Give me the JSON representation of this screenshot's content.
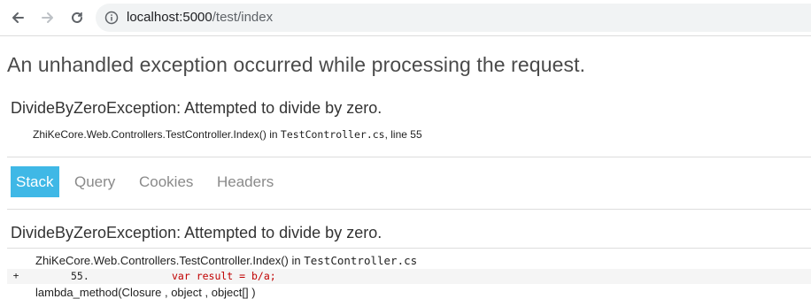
{
  "browser": {
    "url_host": "localhost:5000",
    "url_path": "/test/index"
  },
  "page": {
    "title": "An unhandled exception occurred while processing the request."
  },
  "exception": {
    "title": "DivideByZeroException: Attempted to divide by zero.",
    "method": "ZhiKeCore.Web.Controllers.TestController.Index() in ",
    "file": "TestController.cs",
    "line_text": ", line 55"
  },
  "tabs": [
    {
      "label": "Stack"
    },
    {
      "label": "Query"
    },
    {
      "label": "Cookies"
    },
    {
      "label": "Headers"
    }
  ],
  "stack": {
    "title": "DivideByZeroException: Attempted to divide by zero.",
    "frame_method": "ZhiKeCore.Web.Controllers.TestController.Index() in ",
    "frame_file": "TestController.cs",
    "expander": "+",
    "line_number": "55.",
    "line_code": "var result = b/a;",
    "next_frame": "lambda_method(Closure , object , object[] )"
  }
}
